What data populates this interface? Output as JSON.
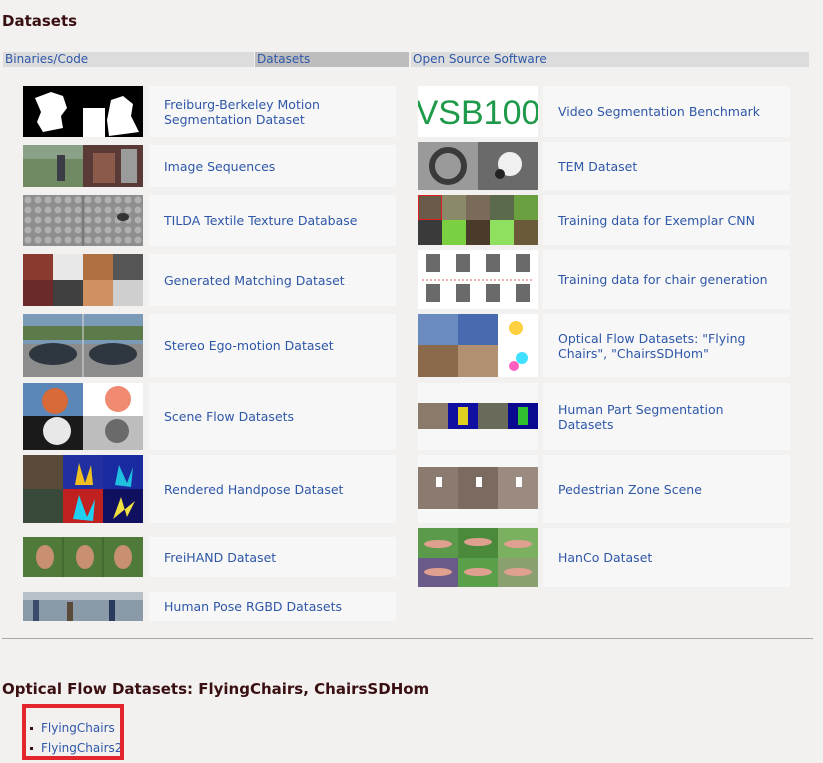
{
  "page_title": "Datasets",
  "tabs": {
    "binaries": "Binaries/Code",
    "datasets": "Datasets",
    "opensource": "Open Source Software"
  },
  "datasets_left": [
    "Freiburg-Berkeley Motion Segmentation Dataset",
    "Image Sequences",
    "TILDA Textile Texture Database",
    "Generated Matching Dataset",
    "Stereo Ego-motion Dataset",
    "Scene Flow Datasets",
    "Rendered Handpose Dataset",
    "FreiHAND Dataset",
    "Human Pose RGBD Datasets"
  ],
  "datasets_right": [
    "Video Segmentation Benchmark",
    "TEM Dataset",
    "Training data for Exemplar CNN",
    "Training data for chair generation",
    "Optical Flow Datasets: \"Flying Chairs\", \"ChairsSDHom\"",
    "Human Part Segmentation Datasets",
    "Pedestrian Zone Scene",
    "HanCo Dataset"
  ],
  "vsb_logo_text": "VSB100",
  "section_heading": "Optical Flow Datasets: FlyingChairs, ChairsSDHom",
  "section_links": [
    "FlyingChairs",
    "FlyingChairs2"
  ],
  "highlight_color": "#e3262b",
  "link_color": "#2e57a8"
}
